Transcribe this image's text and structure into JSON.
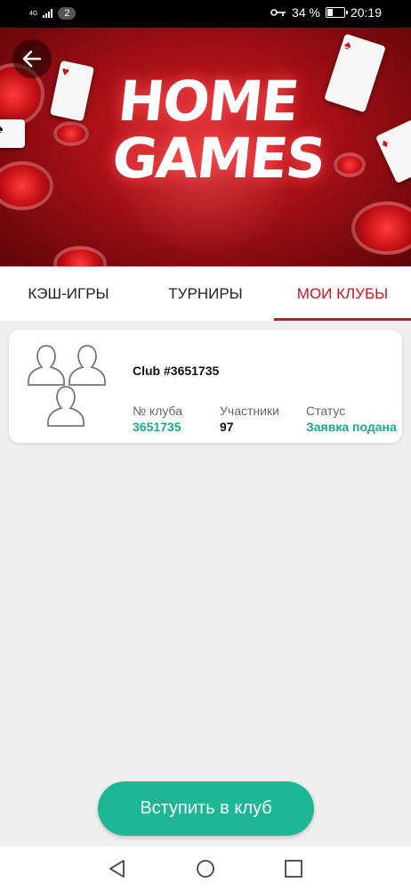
{
  "status_bar": {
    "network": "4G",
    "notification_count": "2",
    "battery_percent": "34 %",
    "battery_level": 0.34,
    "time": "20:19",
    "icons": [
      "signal-icon",
      "key-icon",
      "battery-icon"
    ]
  },
  "banner": {
    "logo_line1": "HOME",
    "logo_line2": "GAMES",
    "back_icon": "arrow-left-icon"
  },
  "tabs": [
    {
      "label": "КЭШ-ИГРЫ",
      "active": false
    },
    {
      "label": "ТУРНИРЫ",
      "active": false
    },
    {
      "label": "МОИ КЛУБЫ",
      "active": true
    }
  ],
  "club": {
    "name": "Club #3651735",
    "fields": [
      {
        "label": "№ клуба",
        "value": "3651735"
      },
      {
        "label": "Участники",
        "value": "97"
      },
      {
        "label": "Статус",
        "value": "Заявка подана"
      }
    ]
  },
  "join_button": {
    "label": "Вступить в клуб"
  },
  "colors": {
    "accent": "#c5162a",
    "teal": "#1eb796",
    "background": "#efefef"
  }
}
